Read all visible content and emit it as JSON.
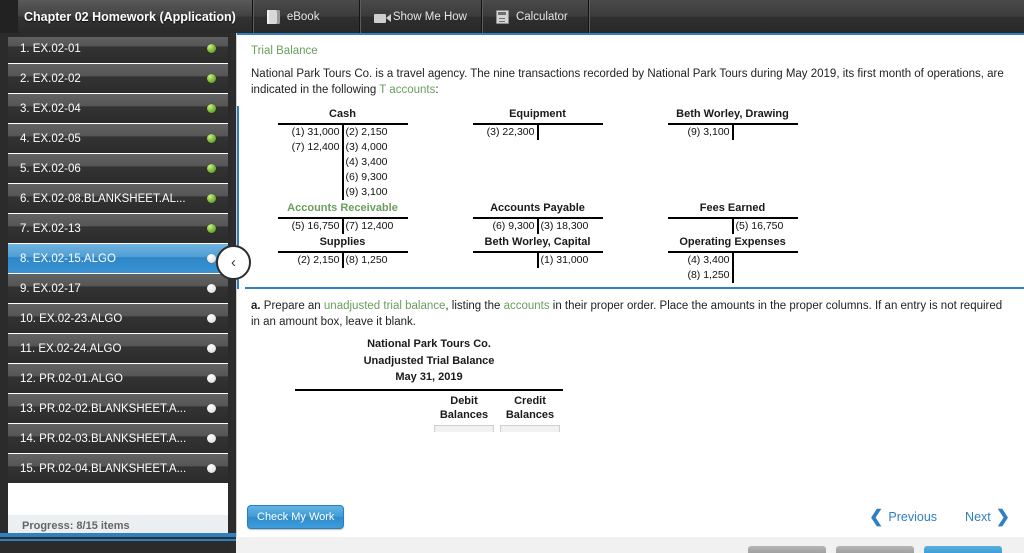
{
  "header": {
    "homework_title": "Chapter 02 Homework (Application)",
    "tabs": [
      {
        "label": "eBook",
        "icon": "book-icon"
      },
      {
        "label": "Show Me How",
        "icon": "video-icon"
      },
      {
        "label": "Calculator",
        "icon": "calculator-icon"
      }
    ]
  },
  "sidebar": {
    "collapse_icon": "‹",
    "progress_label": "Progress:  8/15 items",
    "items": [
      {
        "label": "1. EX.02-01",
        "status": "done",
        "selected": false
      },
      {
        "label": "2. EX.02-02",
        "status": "done",
        "selected": false
      },
      {
        "label": "3. EX.02-04",
        "status": "done",
        "selected": false
      },
      {
        "label": "4. EX.02-05",
        "status": "done",
        "selected": false
      },
      {
        "label": "5. EX.02-06",
        "status": "done",
        "selected": false
      },
      {
        "label": "6. EX.02-08.BLANKSHEET.AL...",
        "status": "done",
        "selected": false
      },
      {
        "label": "7. EX.02-13",
        "status": "done",
        "selected": false
      },
      {
        "label": "8. EX.02-15.ALGO",
        "status": "todo",
        "selected": true
      },
      {
        "label": "9. EX.02-17",
        "status": "todo",
        "selected": false
      },
      {
        "label": "10. EX.02-23.ALGO",
        "status": "todo",
        "selected": false
      },
      {
        "label": "11. EX.02-24.ALGO",
        "status": "todo",
        "selected": false
      },
      {
        "label": "12. PR.02-01.ALGO",
        "status": "todo",
        "selected": false
      },
      {
        "label": "13. PR.02-02.BLANKSHEET.A...",
        "status": "todo",
        "selected": false
      },
      {
        "label": "14. PR.02-03.BLANKSHEET.A...",
        "status": "todo",
        "selected": false
      },
      {
        "label": "15. PR.02-04.BLANKSHEET.A...",
        "status": "todo",
        "selected": false
      }
    ]
  },
  "main": {
    "section_title": "Trial Balance",
    "intro_part1": "National Park Tours Co. is a travel agency. The nine transactions recorded by National Park Tours during May 2019, its first month of operations, are indicated in the following ",
    "intro_link": "T accounts",
    "intro_part2": ":",
    "t_accounts": [
      {
        "name": "Cash",
        "link": false,
        "debits": [
          "(1) 31,000",
          "(7) 12,400"
        ],
        "credits": [
          "(2) 2,150",
          "(3) 4,000",
          "(4) 3,400",
          "(6) 9,300",
          "(9) 3,100"
        ]
      },
      {
        "name": "Equipment",
        "link": false,
        "debits": [
          "(3) 22,300"
        ],
        "credits": []
      },
      {
        "name": "Beth Worley, Drawing",
        "link": false,
        "debits": [
          "(9) 3,100"
        ],
        "credits": []
      },
      {
        "name": "Accounts Receivable",
        "link": true,
        "debits": [
          "(5) 16,750"
        ],
        "credits": [
          "(7) 12,400"
        ]
      },
      {
        "name": "Accounts Payable",
        "link": false,
        "debits": [
          "(6) 9,300"
        ],
        "credits": [
          "(3) 18,300"
        ]
      },
      {
        "name": "Fees Earned",
        "link": false,
        "debits": [],
        "credits": [
          "(5) 16,750"
        ]
      },
      {
        "name": "Supplies",
        "link": false,
        "debits": [
          "(2) 2,150"
        ],
        "credits": [
          "(8) 1,250"
        ]
      },
      {
        "name": "Beth Worley, Capital",
        "link": false,
        "debits": [],
        "credits": [
          "(1) 31,000"
        ]
      },
      {
        "name": "Operating Expenses",
        "link": false,
        "debits": [
          "(4) 3,400",
          "(8) 1,250"
        ],
        "credits": []
      }
    ],
    "requirement": {
      "marker": "a.",
      "text1": "Prepare an ",
      "link1": "unadjusted trial balance",
      "text2": ", listing the ",
      "link2": "accounts",
      "text3": " in their proper order. Place the amounts in the proper columns. If an entry is not required in an amount box, leave it blank."
    },
    "trial_balance": {
      "company": "National Park Tours Co.",
      "statement": "Unadjusted Trial Balance",
      "date": "May 31, 2019",
      "col_debit_line1": "Debit",
      "col_debit_line2": "Balances",
      "col_credit_line1": "Credit",
      "col_credit_line2": "Balances"
    }
  },
  "footer": {
    "check_my_work": "Check My Work",
    "previous": "Previous",
    "next": "Next",
    "prev_chevron": "❮",
    "next_chevron": "❯"
  },
  "colors": {
    "accent_blue": "#2f7fc1",
    "link_green": "#6a9e5e",
    "selected_item": "#3a93d2"
  }
}
